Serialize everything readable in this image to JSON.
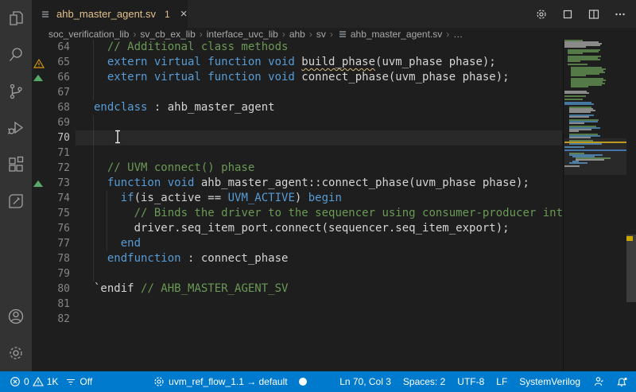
{
  "tab_bar": {
    "tab": {
      "icon": "file-list-icon",
      "label": "ahb_master_agent.sv",
      "badge": "1",
      "close_glyph": "×"
    },
    "actions": [
      {
        "name": "editor-settings-button",
        "icon": "gear-icon"
      },
      {
        "name": "open-changes-button",
        "icon": "square-icon"
      },
      {
        "name": "split-editor-button",
        "icon": "split-editor-icon"
      },
      {
        "name": "more-actions-button",
        "icon": "ellipsis-icon"
      }
    ]
  },
  "breadcrumbs": {
    "separator": "›",
    "items": [
      {
        "label": "soc_verification_lib"
      },
      {
        "label": "sv_cb_ex_lib"
      },
      {
        "label": "interface_uvc_lib"
      },
      {
        "label": "ahb"
      },
      {
        "label": "sv"
      },
      {
        "label": "ahb_master_agent.sv",
        "icon": "file-list-icon"
      },
      {
        "label": "…"
      }
    ]
  },
  "activity_bar": {
    "top": [
      {
        "name": "explorer",
        "icon": "explorer-icon"
      },
      {
        "name": "search",
        "icon": "search-icon"
      },
      {
        "name": "source-control",
        "icon": "source-control-icon"
      },
      {
        "name": "run-debug",
        "icon": "run-debug-icon"
      },
      {
        "name": "extensions",
        "icon": "extensions-icon"
      },
      {
        "name": "custom-extension",
        "icon": "pencil-badge-icon"
      }
    ],
    "bottom": [
      {
        "name": "accounts",
        "icon": "account-icon"
      },
      {
        "name": "manage",
        "icon": "manage-gear-icon"
      }
    ]
  },
  "editor": {
    "current_line": 70,
    "lines": [
      {
        "n": 64,
        "segs": [
          [
            "  ",
            "t"
          ],
          [
            "// Additional class methods",
            "c"
          ]
        ]
      },
      {
        "n": 65,
        "deco": "warning",
        "segs": [
          [
            "  ",
            "t"
          ],
          [
            "extern virtual function void ",
            "k"
          ],
          [
            "build_phase",
            "u"
          ],
          [
            "(uvm_phase phase);",
            "t"
          ]
        ]
      },
      {
        "n": 66,
        "deco": "marker",
        "segs": [
          [
            "  ",
            "t"
          ],
          [
            "extern virtual function void ",
            "k"
          ],
          [
            "connect_phase(uvm_phase phase);",
            "t"
          ]
        ]
      },
      {
        "n": 67,
        "segs": []
      },
      {
        "n": 68,
        "segs": [
          [
            "endclass",
            "k"
          ],
          [
            " : ahb_master_agent",
            "t"
          ]
        ]
      },
      {
        "n": 69,
        "segs": []
      },
      {
        "n": 70,
        "segs": []
      },
      {
        "n": 71,
        "segs": []
      },
      {
        "n": 72,
        "segs": [
          [
            "  ",
            "t"
          ],
          [
            "// UVM connect() phase",
            "c"
          ]
        ]
      },
      {
        "n": 73,
        "deco": "marker",
        "segs": [
          [
            "  ",
            "t"
          ],
          [
            "function void",
            "k"
          ],
          [
            " ahb_master_agent::connect_phase(uvm_phase phase);",
            "t"
          ]
        ]
      },
      {
        "n": 74,
        "segs": [
          [
            "    ",
            "t"
          ],
          [
            "if",
            "k"
          ],
          [
            "(is_active == ",
            "t"
          ],
          [
            "UVM_ACTIVE",
            "k"
          ],
          [
            ") ",
            "t"
          ],
          [
            "begin",
            "k"
          ]
        ]
      },
      {
        "n": 75,
        "segs": [
          [
            "      ",
            "t"
          ],
          [
            "// Binds the driver to the sequencer using consumer-producer int",
            "c"
          ]
        ]
      },
      {
        "n": 76,
        "segs": [
          [
            "      ",
            "t"
          ],
          [
            "driver.seq_item_port.connect(sequencer.seq_item_export);",
            "t"
          ]
        ]
      },
      {
        "n": 77,
        "segs": [
          [
            "    ",
            "t"
          ],
          [
            "end",
            "k"
          ]
        ]
      },
      {
        "n": 78,
        "segs": [
          [
            "  ",
            "t"
          ],
          [
            "endfunction",
            "k"
          ],
          [
            " : connect_phase",
            "t"
          ]
        ]
      },
      {
        "n": 79,
        "segs": []
      },
      {
        "n": 80,
        "segs": [
          [
            "`endif ",
            "t"
          ],
          [
            "// AHB_MASTER_AGENT_SV",
            "c"
          ]
        ]
      },
      {
        "n": 81,
        "segs": []
      },
      {
        "n": 82,
        "segs": []
      }
    ]
  },
  "minimap": {
    "rows": [
      [
        0,
        30,
        "g"
      ],
      [
        0,
        55,
        "w"
      ],
      [
        0,
        60,
        "w"
      ],
      [
        0,
        58,
        "w"
      ],
      [
        0,
        35,
        "w"
      ],
      [
        0,
        0,
        "0"
      ],
      [
        4,
        52,
        "g"
      ],
      [
        4,
        50,
        "g"
      ],
      [
        4,
        24,
        "g"
      ],
      [
        0,
        0,
        "0"
      ],
      [
        4,
        54,
        "g"
      ],
      [
        4,
        49,
        "g"
      ],
      [
        4,
        52,
        "g"
      ],
      [
        4,
        20,
        "g"
      ],
      [
        0,
        0,
        "0"
      ],
      [
        4,
        32,
        "g"
      ],
      [
        0,
        0,
        "0"
      ],
      [
        8,
        50,
        "g"
      ],
      [
        8,
        56,
        "g"
      ],
      [
        8,
        53,
        "g"
      ],
      [
        8,
        55,
        "g"
      ],
      [
        8,
        46,
        "g"
      ],
      [
        8,
        24,
        "g"
      ],
      [
        0,
        0,
        "0"
      ],
      [
        8,
        52,
        "g"
      ],
      [
        8,
        57,
        "g"
      ],
      [
        8,
        51,
        "g"
      ],
      [
        8,
        55,
        "g"
      ],
      [
        8,
        50,
        "g"
      ],
      [
        8,
        28,
        "g"
      ],
      [
        0,
        0,
        "0"
      ],
      [
        0,
        0,
        "0"
      ],
      [
        0,
        36,
        "w"
      ],
      [
        0,
        40,
        "w"
      ],
      [
        0,
        0,
        "0"
      ],
      [
        0,
        34,
        "g"
      ],
      [
        0,
        0,
        "0"
      ],
      [
        0,
        30,
        "g"
      ],
      [
        0,
        0,
        "0"
      ],
      [
        0,
        44,
        "b"
      ],
      [
        0,
        48,
        "b"
      ],
      [
        0,
        0,
        "0"
      ],
      [
        6,
        36,
        "g"
      ],
      [
        6,
        38,
        "w"
      ],
      [
        6,
        42,
        "w"
      ],
      [
        6,
        35,
        "w"
      ],
      [
        0,
        0,
        "0"
      ],
      [
        6,
        40,
        "b"
      ],
      [
        6,
        32,
        "w"
      ],
      [
        0,
        0,
        "0"
      ],
      [
        6,
        48,
        "g"
      ],
      [
        6,
        46,
        "b"
      ],
      [
        6,
        24,
        "w"
      ],
      [
        0,
        0,
        "0"
      ],
      [
        6,
        44,
        "g"
      ],
      [
        6,
        50,
        "b"
      ],
      [
        6,
        36,
        "w"
      ],
      [
        6,
        16,
        "w"
      ],
      [
        0,
        0,
        "0"
      ],
      [
        6,
        46,
        "g"
      ],
      [
        6,
        50,
        "b"
      ],
      [
        6,
        34,
        "w"
      ],
      [
        0,
        0,
        "0"
      ],
      [
        6,
        38,
        "g"
      ],
      [
        0,
        100,
        "y"
      ],
      [
        6,
        52,
        "b"
      ],
      [
        0,
        0,
        "0"
      ],
      [
        0,
        32,
        "b"
      ],
      [
        0,
        0,
        "0"
      ],
      [
        0,
        100,
        "B"
      ],
      [
        0,
        0,
        "0"
      ],
      [
        6,
        24,
        "g"
      ],
      [
        6,
        54,
        "b"
      ],
      [
        10,
        36,
        "b"
      ],
      [
        14,
        56,
        "g"
      ],
      [
        14,
        46,
        "w"
      ],
      [
        10,
        10,
        "b"
      ],
      [
        6,
        30,
        "b"
      ],
      [
        0,
        0,
        "0"
      ],
      [
        0,
        24,
        "w"
      ],
      [
        0,
        0,
        "0"
      ],
      [
        0,
        0,
        "0"
      ]
    ]
  },
  "status_bar": {
    "left": [
      {
        "name": "problems-status",
        "parts": [
          {
            "icon": "error-icon"
          },
          {
            "text": "0"
          },
          {
            "icon": "warning-icon"
          },
          {
            "text": "1K"
          }
        ]
      },
      {
        "name": "filter-off-status",
        "parts": [
          {
            "icon": "filter-icon"
          },
          {
            "text": "Off"
          }
        ]
      },
      {
        "name": "config-status",
        "parts": [
          {
            "icon": "gear-icon"
          },
          {
            "text": "uvm_ref_flow_1.1 → default"
          }
        ]
      },
      {
        "name": "record-status",
        "parts": [
          {
            "icon": "circle-icon"
          }
        ]
      }
    ],
    "right": [
      {
        "name": "cursor-position-status",
        "parts": [
          {
            "text": "Ln 70, Col 3"
          }
        ]
      },
      {
        "name": "indentation-status",
        "parts": [
          {
            "text": "Spaces: 2"
          }
        ]
      },
      {
        "name": "encoding-status",
        "parts": [
          {
            "text": "UTF-8"
          }
        ]
      },
      {
        "name": "eol-status",
        "parts": [
          {
            "text": "LF"
          }
        ]
      },
      {
        "name": "language-status",
        "parts": [
          {
            "text": "SystemVerilog"
          }
        ]
      },
      {
        "name": "feedback-status",
        "parts": [
          {
            "icon": "person-icon"
          }
        ]
      },
      {
        "name": "notifications-status",
        "parts": [
          {
            "icon": "bell-icon"
          }
        ]
      }
    ]
  },
  "colors": {
    "activity_bar_bg": "#333333",
    "tab_bar_bg": "#252526",
    "editor_bg": "#1e1e1e",
    "status_bar_bg": "#007acc",
    "keyword": "#569cd6",
    "comment": "#6a9955",
    "text": "#d4d4d4",
    "modified_tab_label": "#e2c08d",
    "warning": "#cca700",
    "coverage_marker": "#5aa86a",
    "minimap_warning_line": "#b99511",
    "minimap_info_line": "#3a6ea5"
  }
}
